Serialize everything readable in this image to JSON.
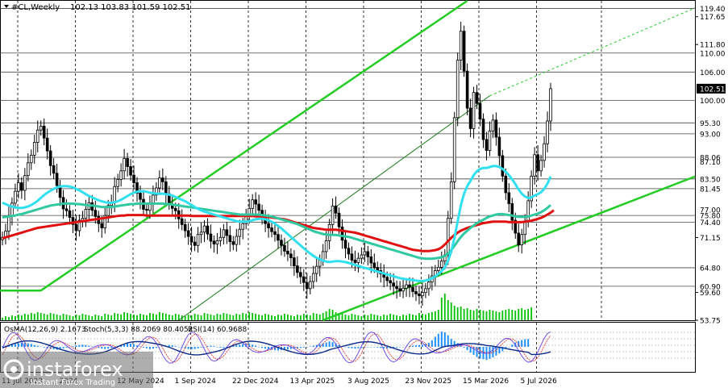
{
  "header": {
    "symbol_text": "#CL,Weekly",
    "ohlc_text": "102.13 103.83 101.59 102.51"
  },
  "indicator_header": {
    "osma_text": "OsMA(12,26,9) 2.1673",
    "stoch_text": "Stoch(5,3,3) 88.2069 80.4052",
    "rsi_text": "RSI(14) 60.9688"
  },
  "logo": {
    "brand": "instaforex",
    "tagline": "Instant Forex Trading"
  },
  "chart_data": {
    "type": "candlestick",
    "symbol": "#CL",
    "timeframe": "Weekly",
    "ohlc_current": {
      "open": 102.13,
      "high": 103.83,
      "low": 101.59,
      "close": 102.51
    },
    "ylim": [
      53.75,
      121.0
    ],
    "y_ticks": [
      "117.65",
      "111.80",
      "71.15",
      "59.60",
      "53.75"
    ],
    "price_levels": [
      {
        "value": 119.4,
        "label": "119.40",
        "has_line": true
      },
      {
        "value": 110.0,
        "label": "110.00",
        "has_line": true
      },
      {
        "value": 106.0,
        "label": "106.00",
        "has_line": true
      },
      {
        "value": 102.51,
        "label": "102.51",
        "current": true
      },
      {
        "value": 100.0,
        "label": "100.00",
        "has_line": true
      },
      {
        "value": 95.3,
        "label": "95.30",
        "has_line": true
      },
      {
        "value": 93.0,
        "label": "93.00",
        "has_line": true
      },
      {
        "value": 88.06,
        "label": "88.06",
        "has_line": true
      },
      {
        "value": 87.1,
        "label": "87.10",
        "has_line": false
      },
      {
        "value": 83.5,
        "label": "83.50",
        "has_line": true
      },
      {
        "value": 81.45,
        "label": "81.45",
        "has_line": true
      },
      {
        "value": 77.0,
        "label": "77.00",
        "has_line": false
      },
      {
        "value": 75.8,
        "label": "75.80",
        "has_line": true
      },
      {
        "value": 74.4,
        "label": "74.40",
        "has_line": true
      },
      {
        "value": 64.8,
        "label": "64.80",
        "has_line": true
      },
      {
        "value": 60.9,
        "label": "60.90",
        "has_line": true
      }
    ],
    "x_labels": [
      "11 Jul 2023",
      "2024",
      "12 May 2024",
      "1 Sep 2024",
      "22 Dec 2024",
      "13 Apr 2025",
      "3 Aug 2025",
      "23 Nov 2025",
      "15 Mar 2026",
      "5 Jul 2026"
    ],
    "closes": [
      71.2,
      72.5,
      75.8,
      78.4,
      80.9,
      82.7,
      81.1,
      84.2,
      86.9,
      88.5,
      91.2,
      93.8,
      94.6,
      92.1,
      89.4,
      86.3,
      84.7,
      82.1,
      79.6,
      77.2,
      76.8,
      75.4,
      73.9,
      72.6,
      74.8,
      75.2,
      77.1,
      78.5,
      76.9,
      75.6,
      74.1,
      73.2,
      75.8,
      77.9,
      78.6,
      81.9,
      83.4,
      85.2,
      87.8,
      86.1,
      84.3,
      82.7,
      80.5,
      79.2,
      77.1,
      76.9,
      78.4,
      80.1,
      81.6,
      83.7,
      82.9,
      80.4,
      78.2,
      77.3,
      76.8,
      75.1,
      73.9,
      72.6,
      71.4,
      70.2,
      69.5,
      71.8,
      72.3,
      73.6,
      71.9,
      70.4,
      69.8,
      70.5,
      71.2,
      72.8,
      71.6,
      70.3,
      69.7,
      71.4,
      72.9,
      74.1,
      75.6,
      77.3,
      79.1,
      78.2,
      76.9,
      75.4,
      74.1,
      73.2,
      72.4,
      71.8,
      70.6,
      69.5,
      68.3,
      67.7,
      66.9,
      65.2,
      63.8,
      62.9,
      61.7,
      60.4,
      61.9,
      63.6,
      65.1,
      66.4,
      68.2,
      70.5,
      73.9,
      77.8,
      76.3,
      73.4,
      70.6,
      68.9,
      67.7,
      66.4,
      65.9,
      66.8,
      67.5,
      68.2,
      67.1,
      65.8,
      64.9,
      64.2,
      63.5,
      62.8,
      62.1,
      61.6,
      60.9,
      60.4,
      59.9,
      60.5,
      61.2,
      60.7,
      59.8,
      59.3,
      58.9,
      59.6,
      60.4,
      61.8,
      63.1,
      64.2,
      64.9,
      66.2,
      67.5,
      75.2,
      82.9,
      96.4,
      108.5,
      114.6,
      106.2,
      98.4,
      94.1,
      101.7,
      99.4,
      96.1,
      91.8,
      89.5,
      93.6,
      95.9,
      92.3,
      88.4,
      84.1,
      80.6,
      78.3,
      74.8,
      72.1,
      69.6,
      71.8,
      74.5,
      78.9,
      84.1,
      88.6,
      85.2,
      87.4,
      90.9,
      95.7,
      102.51
    ],
    "ma_cyan_fast": [
      78.5,
      78.2,
      77.9,
      77.7,
      77.5,
      77.4,
      77.4,
      77.5,
      77.7,
      78.0,
      78.4,
      78.9,
      79.5,
      80.1,
      80.6,
      81.0,
      81.4,
      81.7,
      81.9,
      82.0,
      82.0,
      81.9,
      81.7,
      81.4,
      81.1,
      80.7,
      80.3,
      79.9,
      79.6,
      79.3,
      79.0,
      78.8,
      78.6,
      78.5,
      78.5,
      78.6,
      78.8,
      79.1,
      79.5,
      79.9,
      80.3,
      80.6,
      80.8,
      80.9,
      80.9,
      80.8,
      80.6,
      80.5,
      80.4,
      80.4,
      80.4,
      80.3,
      80.2,
      80.0,
      79.7,
      79.4,
      79.1,
      78.8,
      78.4,
      78.0,
      77.6,
      77.2,
      76.9,
      76.6,
      76.4,
      76.2,
      76.0,
      75.8,
      75.6,
      75.4,
      75.2,
      75.0,
      74.8,
      74.6,
      74.5,
      74.5,
      74.5,
      74.6,
      74.8,
      75.0,
      75.1,
      75.1,
      75.0,
      74.8,
      74.5,
      74.1,
      73.6,
      73.1,
      72.5,
      71.9,
      71.3,
      70.7,
      70.1,
      69.5,
      68.9,
      68.3,
      67.8,
      67.3,
      66.9,
      66.6,
      66.3,
      66.1,
      66.0,
      66.1,
      66.2,
      66.2,
      66.1,
      66.0,
      65.8,
      65.6,
      65.4,
      65.2,
      65.0,
      64.8,
      64.6,
      64.4,
      64.2,
      64.0,
      63.8,
      63.6,
      63.4,
      63.2,
      63.0,
      62.8,
      62.6,
      62.5,
      62.4,
      62.3,
      62.2,
      62.1,
      62.0,
      62.0,
      62.1,
      62.3,
      62.6,
      63.0,
      63.5,
      64.1,
      64.9,
      66.2,
      68.2,
      71.1,
      74.6,
      78.0,
      80.4,
      82.0,
      83.1,
      84.3,
      85.1,
      85.6,
      85.8,
      85.8,
      86.0,
      86.2,
      86.2,
      86.0,
      85.6,
      85.0,
      84.3,
      83.4,
      82.4,
      81.3,
      80.4,
      79.8,
      79.5,
      79.6,
      80.0,
      80.3,
      80.7,
      81.4,
      82.5,
      84.0
    ],
    "ma_teal_mid": [
      75.4,
      75.5,
      75.6,
      75.7,
      75.8,
      76.0,
      76.1,
      76.3,
      76.5,
      76.7,
      76.9,
      77.1,
      77.3,
      77.5,
      77.7,
      77.9,
      78.0,
      78.1,
      78.2,
      78.3,
      78.3,
      78.3,
      78.3,
      78.2,
      78.2,
      78.1,
      78.0,
      77.9,
      77.9,
      77.8,
      77.7,
      77.6,
      77.6,
      77.6,
      77.6,
      77.7,
      77.8,
      77.9,
      78.0,
      78.1,
      78.2,
      78.2,
      78.3,
      78.3,
      78.3,
      78.3,
      78.3,
      78.3,
      78.3,
      78.3,
      78.3,
      78.2,
      78.2,
      78.1,
      78.0,
      77.9,
      77.8,
      77.7,
      77.6,
      77.5,
      77.4,
      77.3,
      77.2,
      77.1,
      77.0,
      76.9,
      76.8,
      76.7,
      76.6,
      76.5,
      76.4,
      76.3,
      76.2,
      76.1,
      76.0,
      76.0,
      76.0,
      76.0,
      76.0,
      76.0,
      76.0,
      75.9,
      75.8,
      75.7,
      75.6,
      75.4,
      75.2,
      75.0,
      74.8,
      74.6,
      74.4,
      74.2,
      74.0,
      73.7,
      73.4,
      73.1,
      72.8,
      72.5,
      72.3,
      72.1,
      71.9,
      71.8,
      71.7,
      71.7,
      71.7,
      71.6,
      71.5,
      71.4,
      71.3,
      71.1,
      70.9,
      70.7,
      70.5,
      70.3,
      70.1,
      69.9,
      69.7,
      69.5,
      69.3,
      69.1,
      68.9,
      68.7,
      68.5,
      68.3,
      68.1,
      67.9,
      67.7,
      67.5,
      67.3,
      67.1,
      66.9,
      66.8,
      66.7,
      66.7,
      66.7,
      66.8,
      66.9,
      67.0,
      67.3,
      67.8,
      68.5,
      69.4,
      70.4,
      71.3,
      72.0,
      72.6,
      73.2,
      73.7,
      74.2,
      74.6,
      74.9,
      75.3,
      75.6,
      75.8,
      76.0,
      76.1,
      76.1,
      76.0,
      75.9,
      75.8,
      75.6,
      75.5,
      75.5,
      75.5,
      75.6,
      75.8,
      76.0,
      76.2,
      76.5,
      76.9,
      77.4,
      78.0
    ],
    "ma_red_slow": [
      71.0,
      71.2,
      71.4,
      71.6,
      71.8,
      72.0,
      72.2,
      72.4,
      72.6,
      72.8,
      73.0,
      73.2,
      73.3,
      73.4,
      73.5,
      73.6,
      73.7,
      73.8,
      73.9,
      74.0,
      74.1,
      74.2,
      74.3,
      74.4,
      74.5,
      74.6,
      74.7,
      74.8,
      74.9,
      75.0,
      75.1,
      75.2,
      75.3,
      75.4,
      75.5,
      75.6,
      75.7,
      75.8,
      75.8,
      75.9,
      75.9,
      75.9,
      75.9,
      75.9,
      75.9,
      75.8,
      75.8,
      75.8,
      75.8,
      75.8,
      75.8,
      75.8,
      75.8,
      75.8,
      75.8,
      75.8,
      75.8,
      75.8,
      75.8,
      75.7,
      75.7,
      75.7,
      75.7,
      75.7,
      75.7,
      75.7,
      75.7,
      75.7,
      75.7,
      75.7,
      75.7,
      75.7,
      75.7,
      75.7,
      75.7,
      75.7,
      75.7,
      75.7,
      75.7,
      75.6,
      75.6,
      75.6,
      75.5,
      75.5,
      75.4,
      75.3,
      75.2,
      75.1,
      75.0,
      74.8,
      74.6,
      74.4,
      74.2,
      74.0,
      73.8,
      73.6,
      73.4,
      73.2,
      73.1,
      73.0,
      72.9,
      72.8,
      72.8,
      72.8,
      72.8,
      72.7,
      72.6,
      72.5,
      72.4,
      72.3,
      72.2,
      72.0,
      71.8,
      71.6,
      71.4,
      71.2,
      71.0,
      70.8,
      70.6,
      70.4,
      70.2,
      70.0,
      69.8,
      69.6,
      69.4,
      69.2,
      69.0,
      68.8,
      68.6,
      68.5,
      68.4,
      68.3,
      68.3,
      68.3,
      68.4,
      68.5,
      68.7,
      69.1,
      69.7,
      70.4,
      71.1,
      71.7,
      72.2,
      72.6,
      72.9,
      73.2,
      73.4,
      73.6,
      73.8,
      74.0,
      74.2,
      74.3,
      74.4,
      74.5,
      74.5,
      74.5,
      74.5,
      74.5,
      74.4,
      74.4,
      74.4,
      74.4,
      74.4,
      74.5,
      74.6,
      74.7,
      74.9,
      75.1,
      75.3,
      75.6,
      76.0,
      76.4,
      76.9
    ],
    "volumes": [
      3,
      5,
      4,
      6,
      5,
      7,
      6,
      8,
      7,
      9,
      8,
      10,
      9,
      8,
      7,
      9,
      8,
      7,
      6,
      8,
      7,
      6,
      5,
      7,
      6,
      8,
      7,
      6,
      5,
      7,
      6,
      5,
      8,
      7,
      6,
      9,
      8,
      7,
      10,
      9,
      8,
      7,
      6,
      8,
      7,
      6,
      9,
      8,
      7,
      10,
      9,
      8,
      7,
      6,
      8,
      7,
      6,
      5,
      7,
      6,
      8,
      7,
      6,
      9,
      8,
      7,
      6,
      8,
      7,
      9,
      8,
      7,
      6,
      8,
      7,
      9,
      8,
      10,
      9,
      8,
      7,
      6,
      8,
      7,
      6,
      5,
      7,
      6,
      8,
      7,
      6,
      5,
      7,
      6,
      8,
      7,
      6,
      9,
      8,
      7,
      9,
      11,
      14,
      13,
      10,
      9,
      8,
      7,
      6,
      8,
      7,
      6,
      5,
      7,
      6,
      8,
      7,
      6,
      5,
      7,
      6,
      8,
      7,
      6,
      5,
      7,
      6,
      8,
      7,
      6,
      9,
      8,
      7,
      9,
      10,
      11,
      13,
      28,
      33,
      25,
      22,
      18,
      16,
      17,
      14,
      15,
      13,
      12,
      14,
      13,
      12,
      11,
      13,
      12,
      11,
      10,
      12,
      13,
      14,
      13,
      12,
      14,
      15,
      13,
      14,
      16
    ],
    "trend_channel": {
      "label": "rising green channel",
      "upper": {
        "from": [
          12,
          60.0
        ],
        "to": [
          145,
          121.0
        ]
      },
      "lower": {
        "from": [
          100,
          53.75
        ],
        "to": [
          172,
          84.0
        ]
      },
      "mid_dashed": {
        "from": [
          55,
          53.75
        ],
        "to": [
          172,
          119.5
        ]
      }
    },
    "histogram_osma": [
      0.2,
      0.3,
      0.5,
      0.6,
      0.8,
      1.0,
      1.1,
      1.2,
      1.0,
      0.8,
      0.5,
      0.3,
      0.1,
      -0.2,
      -0.4,
      -0.6,
      -0.7,
      -0.8,
      -0.6,
      -0.4,
      -0.2,
      0.0,
      0.2,
      0.4,
      0.5,
      0.6,
      0.5,
      0.3,
      0.1,
      -0.1,
      -0.3,
      -0.5,
      -0.6,
      -0.5,
      -0.3,
      -0.1,
      0.2,
      0.5,
      0.8,
      1.0,
      0.9,
      0.7,
      0.4,
      0.1,
      -0.2,
      -0.4,
      -0.6,
      -0.5,
      -0.3,
      -0.1,
      0.1,
      0.3,
      0.5,
      0.4,
      0.2,
      0.0,
      -0.2,
      -0.4,
      -0.6,
      -0.7,
      -0.6,
      -0.4,
      -0.2,
      0.0,
      0.2,
      0.3,
      0.2,
      0.0,
      -0.2,
      -0.3,
      -0.2,
      0.0,
      0.2,
      0.4,
      0.6,
      0.8,
      0.9,
      0.8,
      0.6,
      0.3,
      0.0,
      -0.3,
      -0.5,
      -0.7,
      -0.8,
      -0.9,
      -1.0,
      -0.9,
      -0.8,
      -0.7,
      -0.6,
      -0.5,
      -0.4,
      -0.3,
      -0.2,
      -0.1,
      0.1,
      0.3,
      0.5,
      0.7,
      0.9,
      1.2,
      1.5,
      1.3,
      1.0,
      0.6,
      0.2,
      -0.1,
      -0.3,
      -0.4,
      -0.5,
      -0.4,
      -0.3,
      -0.2,
      -0.1,
      0.0,
      -0.1,
      -0.2,
      -0.3,
      -0.4,
      -0.5,
      -0.4,
      -0.3,
      -0.2,
      -0.1,
      0.0,
      0.1,
      0.2,
      0.3,
      0.4,
      0.5,
      0.6,
      0.8,
      1.1,
      1.8,
      2.8,
      3.6,
      4.2,
      4.0,
      3.2,
      2.2,
      1.6,
      1.0,
      0.4,
      -0.2,
      -0.9,
      -1.6,
      -2.2,
      -2.8,
      -3.2,
      -3.4,
      -3.6,
      -3.3,
      -2.9,
      -2.4,
      -1.8,
      -1.2,
      -0.6,
      0.0,
      0.6,
      1.2,
      1.6,
      1.9,
      2.1,
      2.17
    ]
  }
}
